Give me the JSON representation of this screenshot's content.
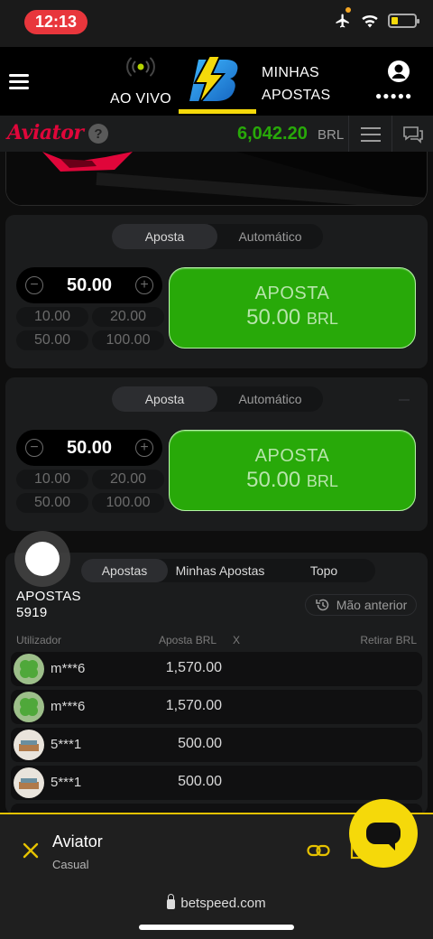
{
  "status_bar": {
    "time": "12:13"
  },
  "header": {
    "live_label": "AO VIVO",
    "my_bets_line1": "MINHAS",
    "my_bets_line2": "APOSTAS",
    "profile_dots": "●●●●●"
  },
  "game_bar": {
    "logo": "Aviator",
    "help": "?",
    "balance": "6,042.20",
    "currency": "BRL"
  },
  "bet_panels": [
    {
      "tabs": [
        "Aposta",
        "Automático"
      ],
      "active_tab": "Aposta",
      "stake": "50.00",
      "quick_amounts": [
        "10.00",
        "20.00",
        "50.00",
        "100.00"
      ],
      "button_label": "APOSTA",
      "button_amount": "50.00",
      "button_currency": "BRL"
    },
    {
      "tabs": [
        "Aposta",
        "Automático"
      ],
      "active_tab": "Aposta",
      "stake": "50.00",
      "quick_amounts": [
        "10.00",
        "20.00",
        "50.00",
        "100.00"
      ],
      "button_label": "APOSTA",
      "button_amount": "50.00",
      "button_currency": "BRL"
    }
  ],
  "bets": {
    "tabs": [
      "Apostas",
      "Minhas Apostas",
      "Topo"
    ],
    "title": "APOSTAS",
    "count": "5919",
    "previous_button": "Mão anterior",
    "columns": {
      "user": "Utilizador",
      "bet": "Aposta BRL",
      "x": "X",
      "cashout": "Retirar BRL"
    },
    "rows": [
      {
        "user": "m***6",
        "amount": "1,570.00"
      },
      {
        "user": "m***6",
        "amount": "1,570.00"
      },
      {
        "user": "5***1",
        "amount": "500.00"
      },
      {
        "user": "5***1",
        "amount": "500.00"
      }
    ]
  },
  "bottom_sheet": {
    "title": "Aviator",
    "subtitle": "Casual"
  },
  "browser": {
    "url": "betspeed.com"
  },
  "colors": {
    "accent_yellow": "#f5d90a",
    "bet_green": "#28a909",
    "aviator_red": "#e0063a",
    "time_red": "#e8363c"
  }
}
